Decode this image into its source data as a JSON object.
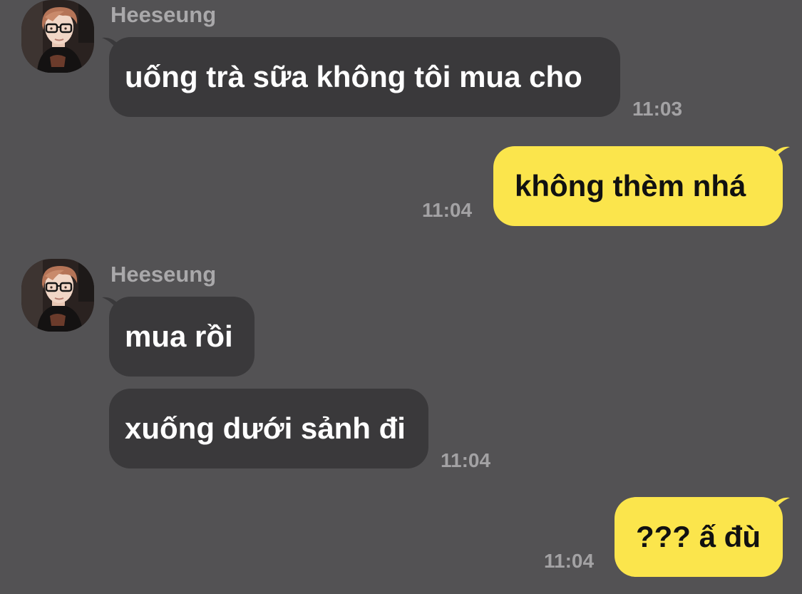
{
  "colors": {
    "background": "#535254",
    "incoming_bubble": "#3a393b",
    "outgoing_bubble": "#fbe54c",
    "sender_name": "#a9a8aa",
    "timestamp": "#a3a2a4"
  },
  "messages": [
    {
      "sender": "Heeseung",
      "avatar_icon": "profile-photo-icon",
      "text": "uống trà sữa không tôi mua cho",
      "time": "11:03"
    },
    {
      "text": "không thèm nhá",
      "time": "11:04"
    },
    {
      "sender": "Heeseung",
      "avatar_icon": "profile-photo-icon",
      "text": "mua rồi"
    },
    {
      "text": "xuống dưới sảnh đi",
      "time": "11:04"
    },
    {
      "text": "??? ấ đù",
      "time": "11:04"
    }
  ]
}
